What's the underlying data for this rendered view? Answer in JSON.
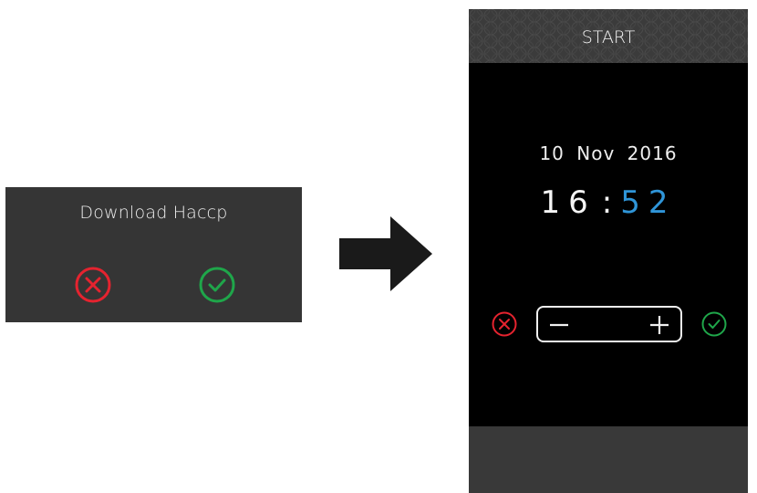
{
  "dialog": {
    "title": "Download Haccp",
    "cancel_icon": "cancel-circle-icon",
    "confirm_icon": "check-circle-icon"
  },
  "transition_icon": "arrow-right-icon",
  "device": {
    "header_title": "START",
    "date": {
      "day": "10",
      "month": "Nov",
      "year": "2016"
    },
    "time": {
      "hours": "16",
      "separator": ":",
      "minutes": "52"
    },
    "stepper": {
      "minus_icon": "minus-icon",
      "plus_icon": "plus-icon"
    },
    "cancel_icon": "cancel-circle-icon",
    "confirm_icon": "check-circle-icon"
  },
  "colors": {
    "cancel": "#e5232f",
    "confirm": "#1fa64a",
    "time_minutes": "#2f95d8",
    "dialog_bg": "#353535",
    "screen_bg": "#000000"
  }
}
